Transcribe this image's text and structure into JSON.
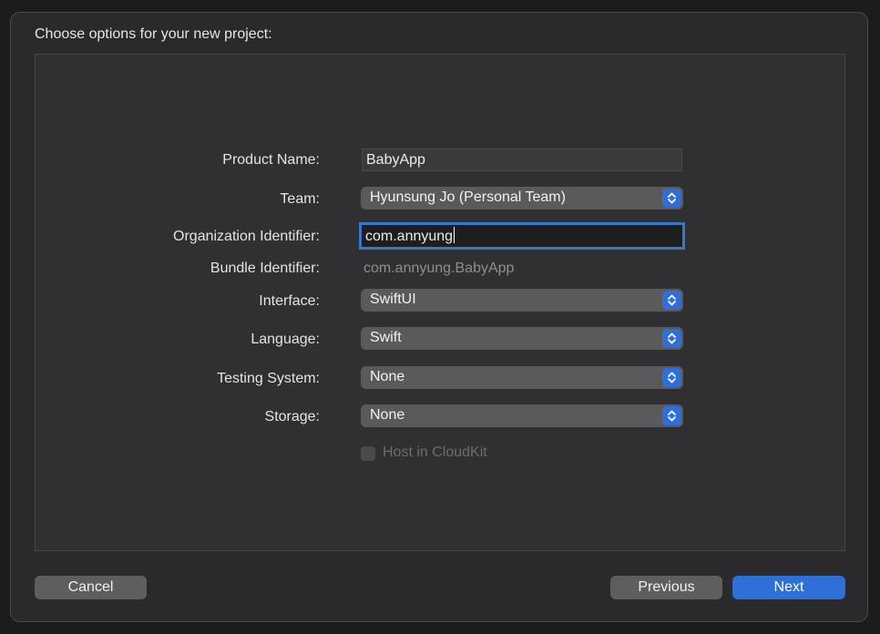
{
  "sheet": {
    "title": "Choose options for your new project:"
  },
  "form": {
    "product_name": {
      "label": "Product Name:",
      "value": "BabyApp"
    },
    "team": {
      "label": "Team:",
      "value": "Hyunsung Jo (Personal Team)"
    },
    "organization_identifier": {
      "label": "Organization Identifier:",
      "value": "com.annyung"
    },
    "bundle_identifier": {
      "label": "Bundle Identifier:",
      "value": "com.annyung.BabyApp"
    },
    "interface": {
      "label": "Interface:",
      "value": "SwiftUI"
    },
    "language": {
      "label": "Language:",
      "value": "Swift"
    },
    "testing_system": {
      "label": "Testing System:",
      "value": "None"
    },
    "storage": {
      "label": "Storage:",
      "value": "None"
    },
    "host_in_cloudkit": {
      "label": "Host in CloudKit",
      "checked": false,
      "enabled": false
    }
  },
  "buttons": {
    "cancel": "Cancel",
    "previous": "Previous",
    "next": "Next"
  },
  "colors": {
    "accent": "#2e6fd8",
    "focus_ring": "#3478c8"
  },
  "icons": {
    "popup_stepper": "chevron-up-down-icon"
  }
}
